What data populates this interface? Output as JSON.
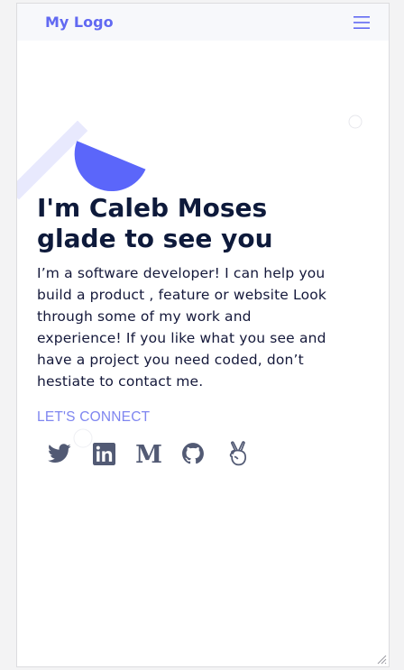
{
  "navbar": {
    "logo_text": "My Logo",
    "menu_icon": "hamburger-menu-icon"
  },
  "hero": {
    "title_line1": "I'm Caleb Moses",
    "title_line2": "glade to see you",
    "intro": "I’m a software developer! I can help you build a product , feature or website Look through some of my work and experience! If you like what you see and have a project you need coded, don’t hestiate to contact me.",
    "connect_label": "LET'S CONNECT"
  },
  "social_links": [
    {
      "name": "twitter",
      "icon": "twitter-icon"
    },
    {
      "name": "linkedin",
      "icon": "linkedin-icon"
    },
    {
      "name": "medium",
      "icon": "medium-icon"
    },
    {
      "name": "github",
      "icon": "github-icon"
    },
    {
      "name": "angellist",
      "icon": "angellist-icon"
    }
  ],
  "colors": {
    "brand": "#6169f2",
    "accent_shape": "#5b66fa",
    "accent_light": "#e8e9fd",
    "heading": "#0e1a3b",
    "icons": "#525a74"
  }
}
